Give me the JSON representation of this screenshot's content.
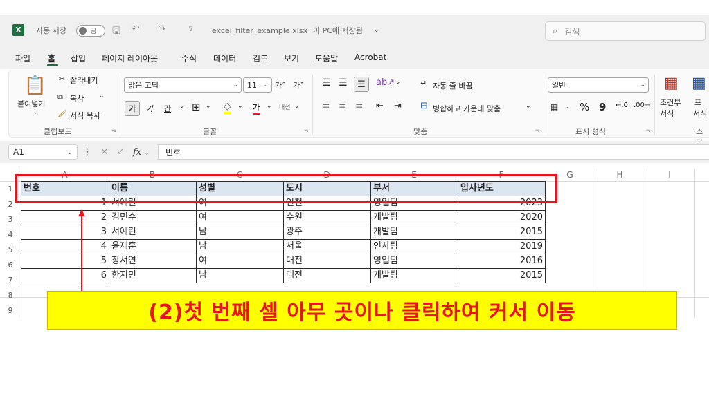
{
  "titlebar": {
    "logo": "X",
    "autosave_label": "자동 저장",
    "autosave_state": "끔",
    "filename": "excel_filter_example.xlsx",
    "save_location": "이 PC에 저장됨",
    "search_placeholder": "검색"
  },
  "menu": [
    "파일",
    "홈",
    "삽입",
    "페이지 레이아웃",
    "수식",
    "데이터",
    "검토",
    "보기",
    "도움말",
    "Acrobat"
  ],
  "ribbon": {
    "clipboard": {
      "paste": "붙여넣기",
      "cut": "잘라내기",
      "copy": "복사",
      "format_painter": "서식 복사",
      "label": "클립보드"
    },
    "font": {
      "name": "맑은 고딕",
      "size": "11",
      "grow": "가ˆ",
      "shrink": "가ˇ",
      "bold": "가",
      "italic": "가",
      "underline": "간",
      "font_color": "가",
      "phonetic": "내선",
      "label": "글꼴"
    },
    "alignment": {
      "wrap_text": "자동 줄 바꿈",
      "merge_center": "병합하고 가운데 맞춤",
      "label": "맞춤"
    },
    "number": {
      "format": "일반",
      "percent": "%",
      "comma": "9",
      "label": "표시 형식"
    },
    "styles": {
      "conditional": "조건부",
      "conditional2": "서식",
      "table": "표",
      "table2": "서식",
      "label": "스타"
    }
  },
  "formula_bar": {
    "name_box": "A1",
    "fx": "fx",
    "content": "번호"
  },
  "grid": {
    "columns": [
      "A",
      "B",
      "C",
      "D",
      "E",
      "F",
      "G",
      "H",
      "I"
    ],
    "rows": [
      "1",
      "2",
      "3",
      "4",
      "5",
      "6",
      "7",
      "8",
      "9"
    ],
    "header": [
      "번호",
      "이름",
      "성별",
      "도시",
      "부서",
      "입사년도"
    ],
    "data": [
      [
        "1",
        "서예린",
        "여",
        "인천",
        "영업팀",
        "2023"
      ],
      [
        "2",
        "김민수",
        "여",
        "수원",
        "개발팀",
        "2020"
      ],
      [
        "3",
        "서예린",
        "남",
        "광주",
        "개발팀",
        "2015"
      ],
      [
        "4",
        "윤재훈",
        "남",
        "서울",
        "인사팀",
        "2019"
      ],
      [
        "5",
        "장서연",
        "여",
        "대전",
        "영업팀",
        "2016"
      ],
      [
        "6",
        "한지민",
        "남",
        "대전",
        "개발팀",
        "2015"
      ]
    ]
  },
  "annotation": {
    "banner": "(2)첫 번째 셀 아무 곳이나 클릭하여 커서 이동",
    "accent_color": "#e8141e",
    "banner_color": "#ffff00"
  }
}
